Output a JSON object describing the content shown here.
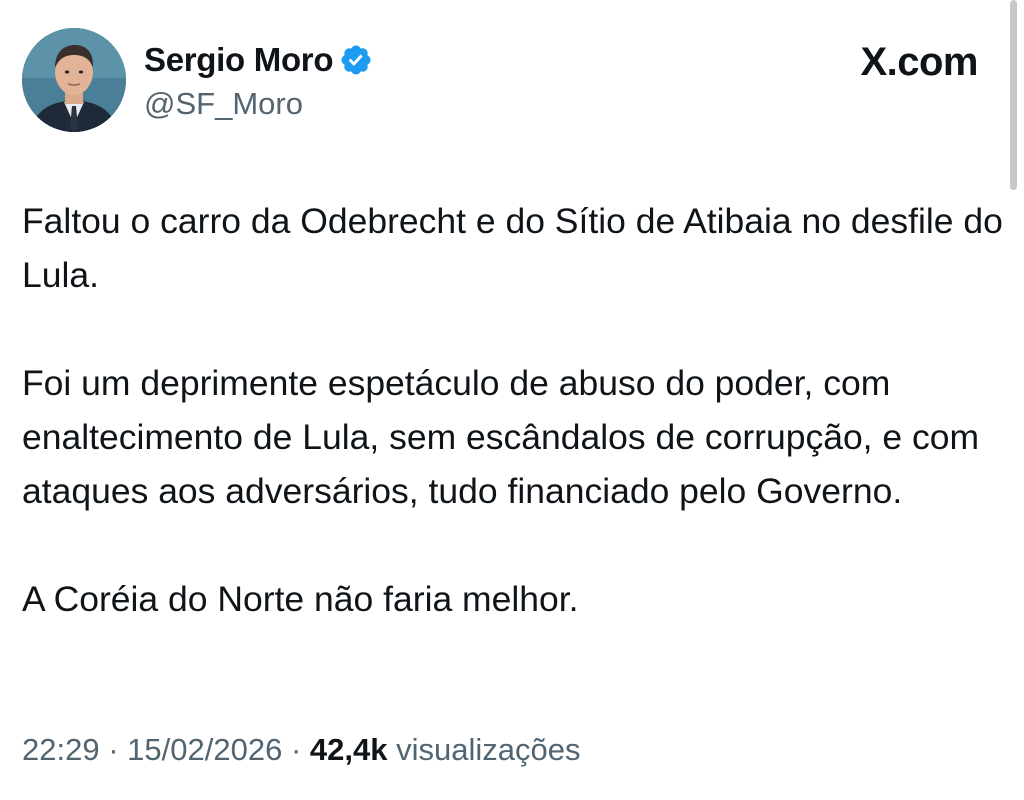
{
  "author": {
    "display_name": "Sergio Moro",
    "handle": "@SF_Moro",
    "verified": true,
    "verified_badge_icon": "verified-badge-icon",
    "avatar_icon": "avatar-photo"
  },
  "brand": {
    "label": "X.com"
  },
  "tweet": {
    "paragraphs": [
      "Faltou o carro da Odebrecht e do Sítio de Atibaia no desfile do Lula.",
      "Foi um deprimente espetáculo de abuso do poder, com enaltecimento de Lula, sem escândalos de corrupção, e com ataques aos adversários, tudo financiado pelo Governo.",
      "A Coréia do Norte não faria melhor."
    ]
  },
  "meta": {
    "time": "22:29",
    "separator": "·",
    "date": "15/02/2026",
    "views_count": "42,4k",
    "views_label": "visualizações"
  },
  "colors": {
    "text_primary": "#0f1419",
    "text_secondary": "#536471",
    "verified_blue": "#1d9bf0"
  }
}
